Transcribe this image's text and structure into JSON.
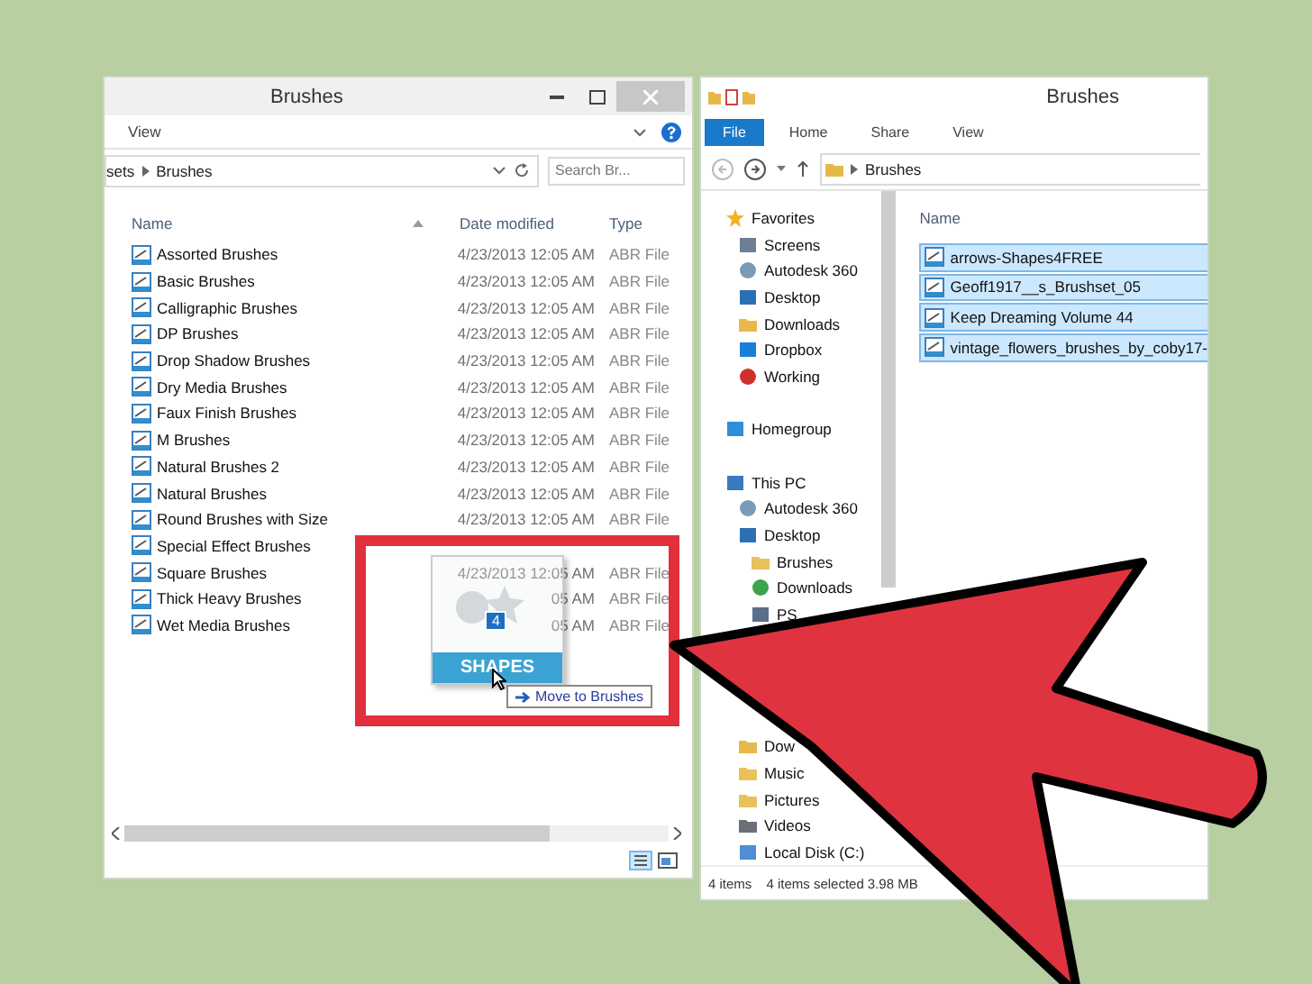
{
  "left_window": {
    "title": "Brushes",
    "ribbon_tab": "View",
    "address": {
      "parent": "sets",
      "current": "Brushes"
    },
    "search": {
      "placeholder": "Search Br..."
    },
    "columns": [
      "Name",
      "Date modified",
      "Type"
    ],
    "rows": [
      {
        "name": "Assorted Brushes",
        "date": "4/23/2013 12:05 AM",
        "type": "ABR File"
      },
      {
        "name": "Basic Brushes",
        "date": "4/23/2013 12:05 AM",
        "type": "ABR File"
      },
      {
        "name": "Calligraphic Brushes",
        "date": "4/23/2013 12:05 AM",
        "type": "ABR File"
      },
      {
        "name": "DP Brushes",
        "date": "4/23/2013 12:05 AM",
        "type": "ABR File"
      },
      {
        "name": "Drop Shadow Brushes",
        "date": "4/23/2013 12:05 AM",
        "type": "ABR File"
      },
      {
        "name": "Dry Media Brushes",
        "date": "4/23/2013 12:05 AM",
        "type": "ABR File"
      },
      {
        "name": "Faux Finish Brushes",
        "date": "4/23/2013 12:05 AM",
        "type": "ABR File"
      },
      {
        "name": "M Brushes",
        "date": "4/23/2013 12:05 AM",
        "type": "ABR File"
      },
      {
        "name": "Natural Brushes 2",
        "date": "4/23/2013 12:05 AM",
        "type": "ABR File"
      },
      {
        "name": "Natural Brushes",
        "date": "4/23/2013 12:05 AM",
        "type": "ABR File"
      },
      {
        "name": "Round Brushes with Size",
        "date": "4/23/2013 12:05 AM",
        "type": "ABR File"
      },
      {
        "name": "Special Effect Brushes"
      },
      {
        "name": "Square Brushes",
        "date": "4/23/2013 12:05 AM",
        "type": "ABR File"
      },
      {
        "name": "Thick Heavy Brushes",
        "date": "05 AM",
        "type": "ABR File"
      },
      {
        "name": "Wet Media Brushes",
        "date": "05 AM",
        "type": "ABR File"
      }
    ]
  },
  "drag": {
    "badge": "4",
    "label": "SHAPES",
    "tooltip": "Move to Brushes"
  },
  "right_window": {
    "title": "Brushes",
    "tabs": [
      {
        "label": "File",
        "selected": true
      },
      {
        "label": "Home",
        "selected": false
      },
      {
        "label": "Share",
        "selected": false
      },
      {
        "label": "View",
        "selected": false
      }
    ],
    "address": "Brushes",
    "nav": [
      {
        "label": "Favorites",
        "children": [
          {
            "label": "Screens"
          },
          {
            "label": "Autodesk 360"
          },
          {
            "label": "Desktop"
          },
          {
            "label": "Downloads"
          },
          {
            "label": "Dropbox"
          },
          {
            "label": "Working"
          }
        ]
      },
      {
        "label": "Homegroup"
      },
      {
        "label": "This PC",
        "children": [
          {
            "label": "Autodesk 360"
          },
          {
            "label": "Desktop",
            "children": [
              {
                "label": "Brushes"
              },
              {
                "label": "Downloads"
              },
              {
                "label": "PS"
              }
            ]
          },
          {
            "label": "Dow",
            "kind": "partial"
          },
          {
            "label": "Music"
          },
          {
            "label": "Pictures"
          },
          {
            "label": "Videos"
          },
          {
            "label": "Local Disk (C:)"
          }
        ]
      }
    ],
    "column": "Name",
    "files": [
      {
        "name": "arrows-Shapes4FREE",
        "selected": true
      },
      {
        "name": "Geoff1917__s_Brushset_05",
        "selected": true
      },
      {
        "name": "Keep Dreaming Volume 44",
        "selected": true
      },
      {
        "name": "vintage_flowers_brushes_by_coby17-",
        "selected": true
      }
    ],
    "status": {
      "count": "4 items",
      "selection": "4 items selected",
      "size": "3.98 MB"
    }
  }
}
